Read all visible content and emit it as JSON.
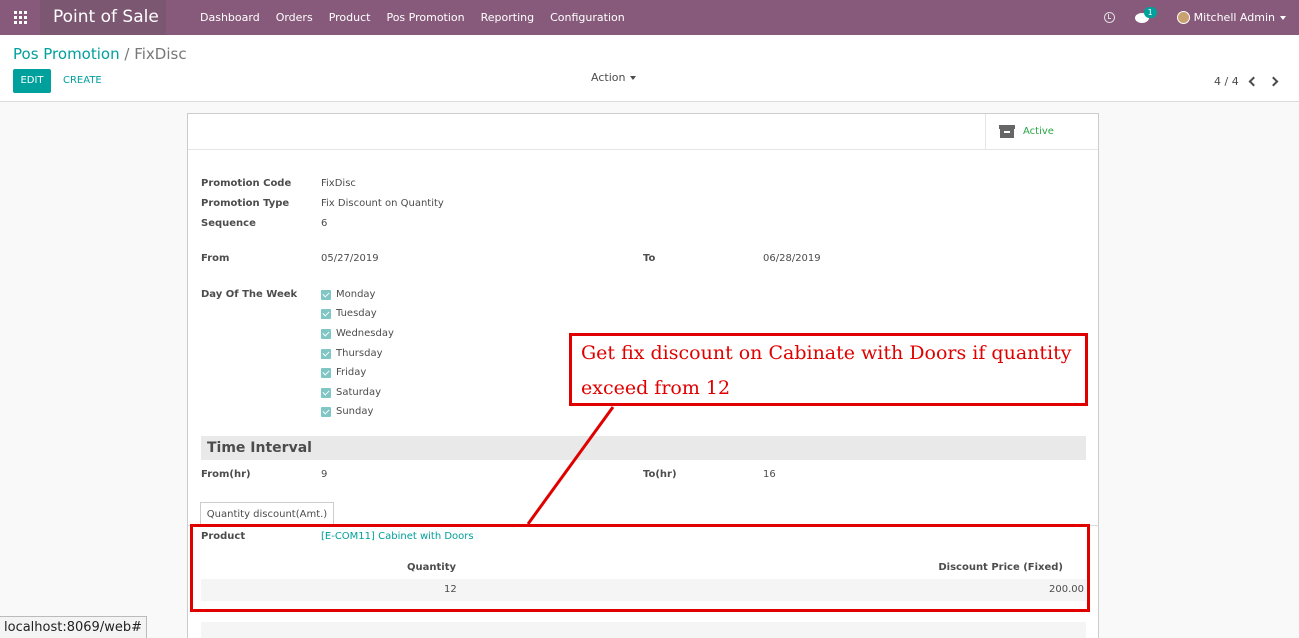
{
  "navbar": {
    "app_name": "Point of Sale",
    "menu": [
      "Dashboard",
      "Orders",
      "Product",
      "Pos Promotion",
      "Reporting",
      "Configuration"
    ],
    "chat_badge": "1",
    "user_name": "Mitchell Admin"
  },
  "control_panel": {
    "breadcrumb_parent": "Pos Promotion",
    "breadcrumb_separator": "/",
    "breadcrumb_current": "FixDisc",
    "edit_label": "EDIT",
    "create_label": "CREATE",
    "action_label": "Action",
    "pager": "4 / 4"
  },
  "form": {
    "status_label": "Active",
    "promotion_code_label": "Promotion Code",
    "promotion_code": "FixDisc",
    "promotion_type_label": "Promotion Type",
    "promotion_type": "Fix Discount on Quantity",
    "sequence_label": "Sequence",
    "sequence": "6",
    "from_label": "From",
    "from_date": "05/27/2019",
    "to_label": "To",
    "to_date": "06/28/2019",
    "dow_label": "Day Of The Week",
    "days": [
      "Monday",
      "Tuesday",
      "Wednesday",
      "Thursday",
      "Friday",
      "Saturday",
      "Sunday"
    ],
    "time_interval_title": "Time Interval",
    "from_hr_label": "From(hr)",
    "from_hr": "9",
    "to_hr_label": "To(hr)",
    "to_hr": "16",
    "tab_label": "Quantity discount(Amt.)",
    "product_label": "Product",
    "product_value": "[E-COM11] Cabinet with Doors",
    "table": {
      "columns": [
        "Quantity",
        "Discount Price (Fixed)"
      ],
      "rows": [
        [
          "12",
          "200.00"
        ]
      ]
    }
  },
  "annotation": {
    "line1": "Get fix discount on Cabinate with Doors if quantity",
    "line2": "exceed from 12",
    "color": "#e00000"
  },
  "status_bar": "localhost:8069/web#",
  "colors": {
    "navbar": "#875a7b",
    "accent": "#00a09d",
    "active": "#28a745"
  }
}
